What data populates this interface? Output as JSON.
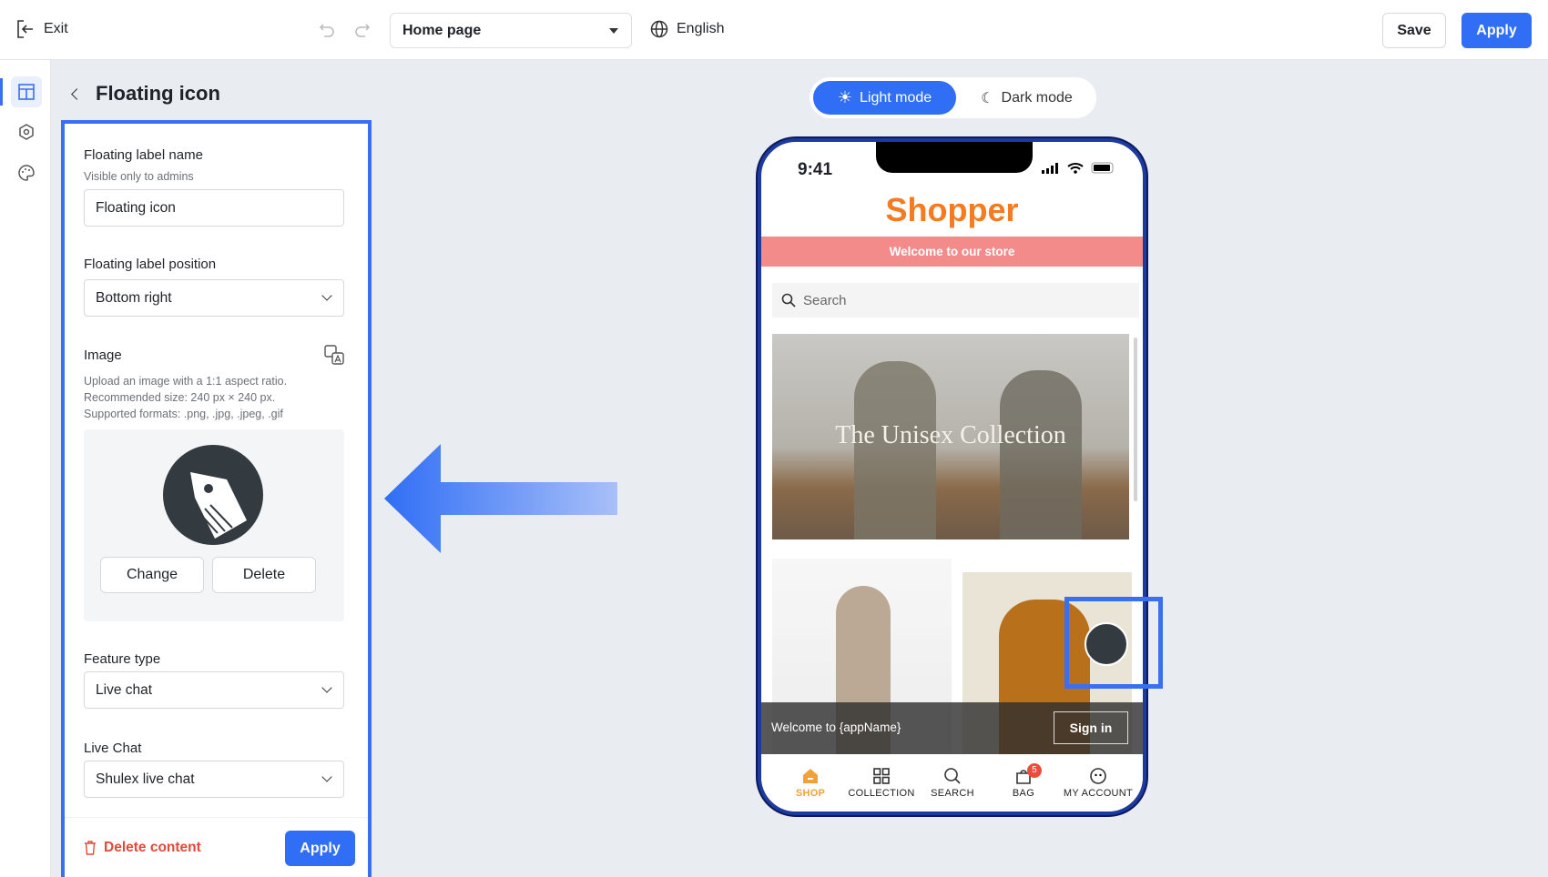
{
  "topbar": {
    "exit": "Exit",
    "page_select": "Home page",
    "language": "English",
    "save": "Save",
    "apply": "Apply"
  },
  "panel": {
    "title": "Floating icon",
    "label_name": {
      "label": "Floating label name",
      "hint": "Visible only to admins",
      "value": "Floating icon"
    },
    "label_position": {
      "label": "Floating label position",
      "value": "Bottom right"
    },
    "image": {
      "label": "Image",
      "hint1": "Upload an image with a 1:1 aspect ratio.",
      "hint2": "Recommended size: 240 px × 240 px.",
      "hint3": "Supported formats: .png, .jpg, .jpeg, .gif",
      "change": "Change",
      "delete": "Delete"
    },
    "feature_type": {
      "label": "Feature type",
      "value": "Live chat"
    },
    "live_chat": {
      "label": "Live Chat",
      "value": "Shulex live chat"
    },
    "delete_content": "Delete content",
    "apply": "Apply"
  },
  "preview": {
    "light_mode": "Light mode",
    "dark_mode": "Dark mode"
  },
  "phone": {
    "time": "9:41",
    "store_name": "Shopper",
    "banner": "Welcome to our store",
    "search_placeholder": "Search",
    "hero_text": "The Unisex Collection",
    "welcome": "Welcome to {appName}",
    "sign_in": "Sign in",
    "nav": [
      {
        "label": "SHOP"
      },
      {
        "label": "COLLECTION"
      },
      {
        "label": "SEARCH"
      },
      {
        "label": "BAG",
        "badge": "5"
      },
      {
        "label": "MY ACCOUNT"
      }
    ]
  },
  "colors": {
    "accent": "#3a6ff2",
    "brand": "#f47b20",
    "banner": "#f48b8b",
    "danger": "#e5483b"
  }
}
